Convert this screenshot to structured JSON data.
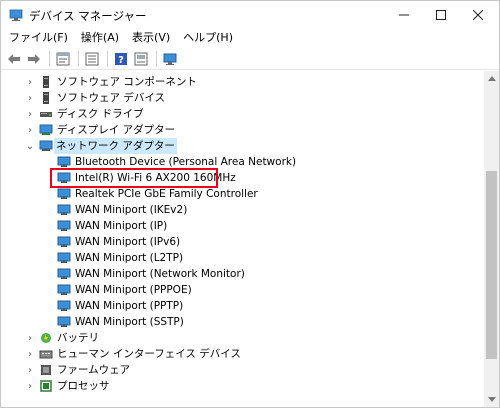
{
  "window": {
    "title": "デバイス マネージャー",
    "minimize_icon": "minimize-icon",
    "maximize_icon": "maximize-icon",
    "close_icon": "close-icon"
  },
  "menu": {
    "items": [
      {
        "label": "ファイル(F)"
      },
      {
        "label": "操作(A)"
      },
      {
        "label": "表示(V)"
      },
      {
        "label": "ヘルプ(H)"
      }
    ]
  },
  "toolbar": {
    "buttons": [
      "back-arrow-icon",
      "forward-arrow-icon",
      "properties-icon",
      "list-icon",
      "help-icon",
      "view-icon",
      "monitor-icon"
    ]
  },
  "tree": {
    "items": [
      {
        "label": "ソフトウェア コンポーネント",
        "level": 0,
        "expanded": false,
        "icon": "software-component-icon"
      },
      {
        "label": "ソフトウェア デバイス",
        "level": 0,
        "expanded": false,
        "icon": "software-device-icon"
      },
      {
        "label": "ディスク ドライブ",
        "level": 0,
        "expanded": false,
        "icon": "disk-drive-icon"
      },
      {
        "label": "ディスプレイ アダプター",
        "level": 0,
        "expanded": false,
        "icon": "display-adapter-icon"
      },
      {
        "label": "ネットワーク アダプター",
        "level": 0,
        "expanded": true,
        "icon": "network-adapter-icon"
      },
      {
        "label": "Bluetooth Device (Personal Area Network)",
        "level": 1,
        "icon": "network-device-icon"
      },
      {
        "label": "Intel(R) Wi-Fi 6 AX200 160MHz",
        "level": 1,
        "icon": "network-device-icon"
      },
      {
        "label": "Realtek PCIe GbE Family Controller",
        "level": 1,
        "icon": "network-device-icon"
      },
      {
        "label": "WAN Miniport (IKEv2)",
        "level": 1,
        "icon": "network-device-icon"
      },
      {
        "label": "WAN Miniport (IP)",
        "level": 1,
        "icon": "network-device-icon"
      },
      {
        "label": "WAN Miniport (IPv6)",
        "level": 1,
        "icon": "network-device-icon"
      },
      {
        "label": "WAN Miniport (L2TP)",
        "level": 1,
        "icon": "network-device-icon"
      },
      {
        "label": "WAN Miniport (Network Monitor)",
        "level": 1,
        "icon": "network-device-icon"
      },
      {
        "label": "WAN Miniport (PPPOE)",
        "level": 1,
        "icon": "network-device-icon"
      },
      {
        "label": "WAN Miniport (PPTP)",
        "level": 1,
        "icon": "network-device-icon"
      },
      {
        "label": "WAN Miniport (SSTP)",
        "level": 1,
        "icon": "network-device-icon"
      },
      {
        "label": "バッテリ",
        "level": 0,
        "expanded": false,
        "icon": "battery-icon"
      },
      {
        "label": "ヒューマン インターフェイス デバイス",
        "level": 0,
        "expanded": false,
        "icon": "hid-icon"
      },
      {
        "label": "ファームウェア",
        "level": 0,
        "expanded": false,
        "icon": "firmware-icon"
      },
      {
        "label": "プロセッサ",
        "level": 0,
        "expanded": false,
        "icon": "processor-icon"
      }
    ]
  },
  "colors": {
    "highlight_border": "#e8001c",
    "selection": "#cce8ff",
    "network_icon": "#3a8fd6"
  }
}
